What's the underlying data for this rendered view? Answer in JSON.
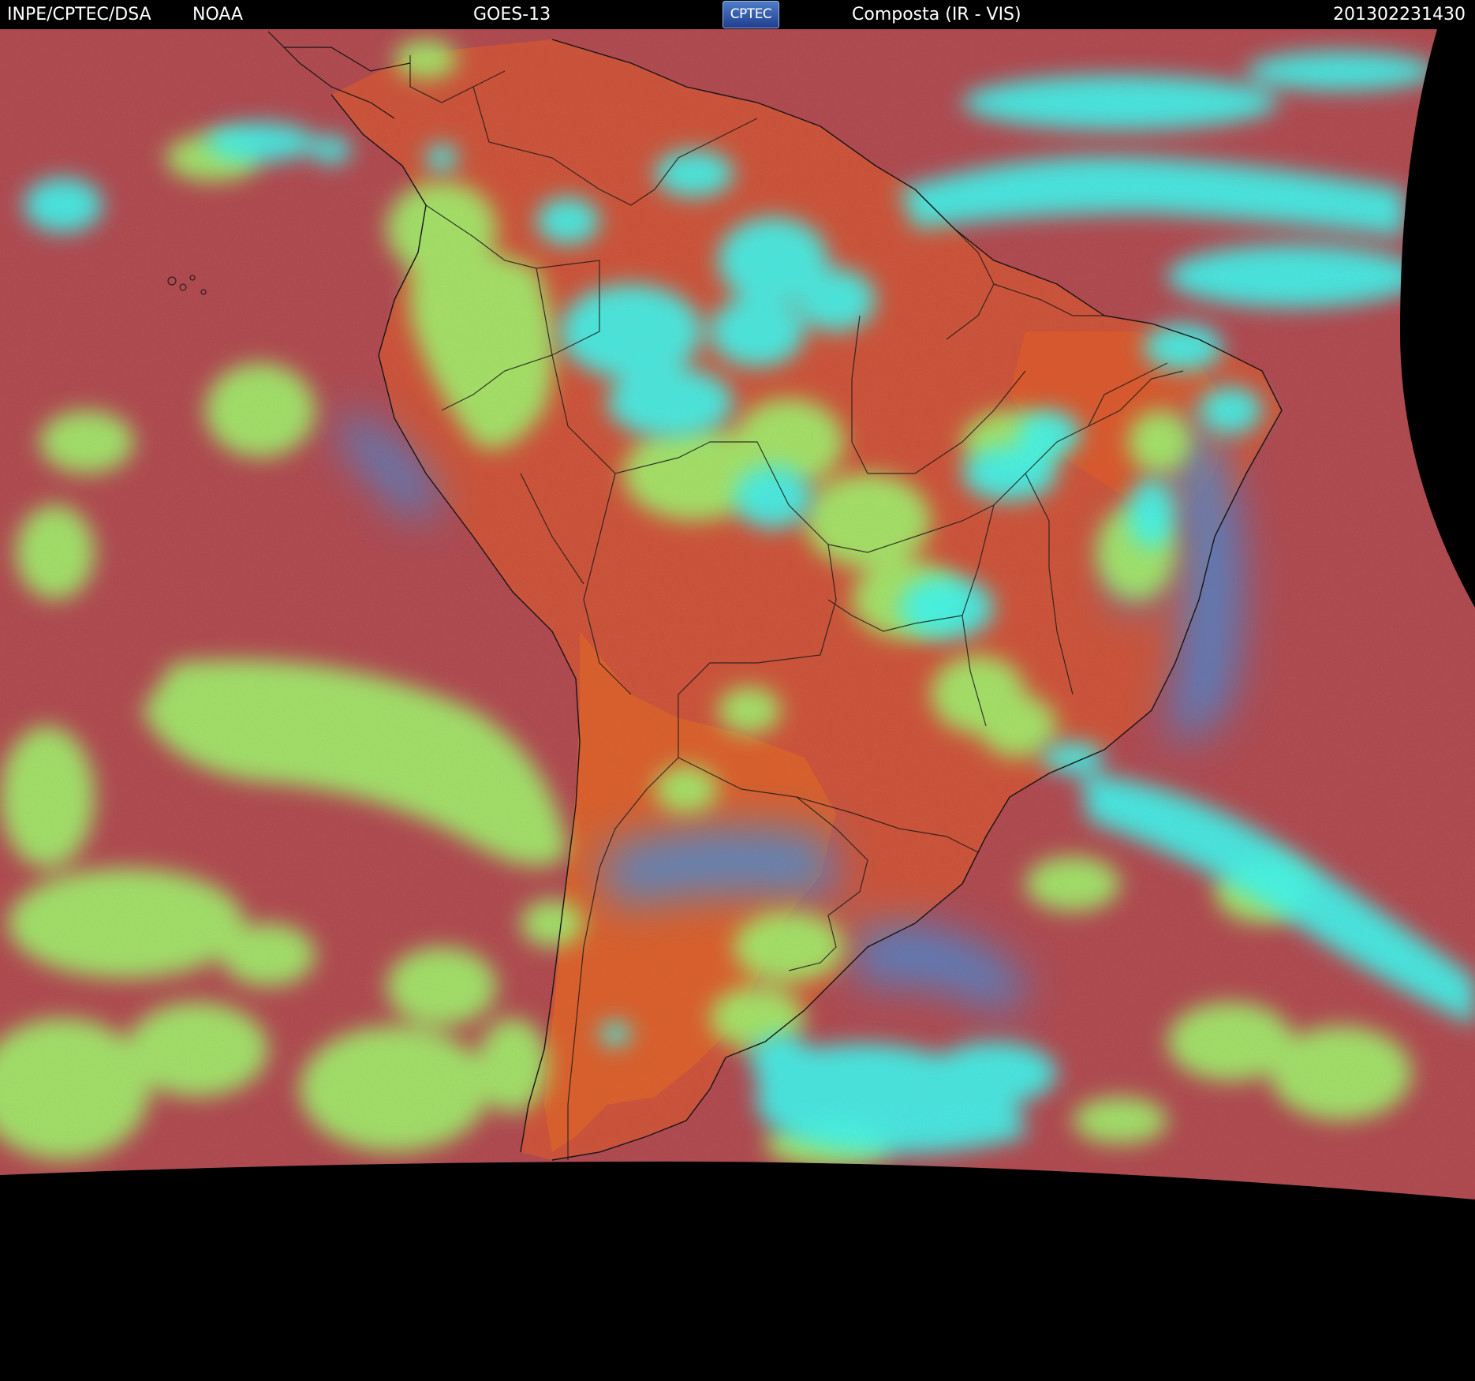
{
  "header": {
    "institution": "INPE/CPTEC/DSA",
    "agency": "NOAA",
    "satellite": "GOES-13",
    "logo_text": "CPTEC",
    "product": "Composta (IR - VIS)",
    "timestamp": "201302231430"
  },
  "colors": {
    "ocean_clear": "#b04a4e",
    "land_clear": "#d5552e",
    "low_cloud": "#9ee86a",
    "high_cloud": "#39f2ec",
    "thin_cirrus": "#3f93dc",
    "borders": "#1a1a1a",
    "background": "#000000"
  }
}
